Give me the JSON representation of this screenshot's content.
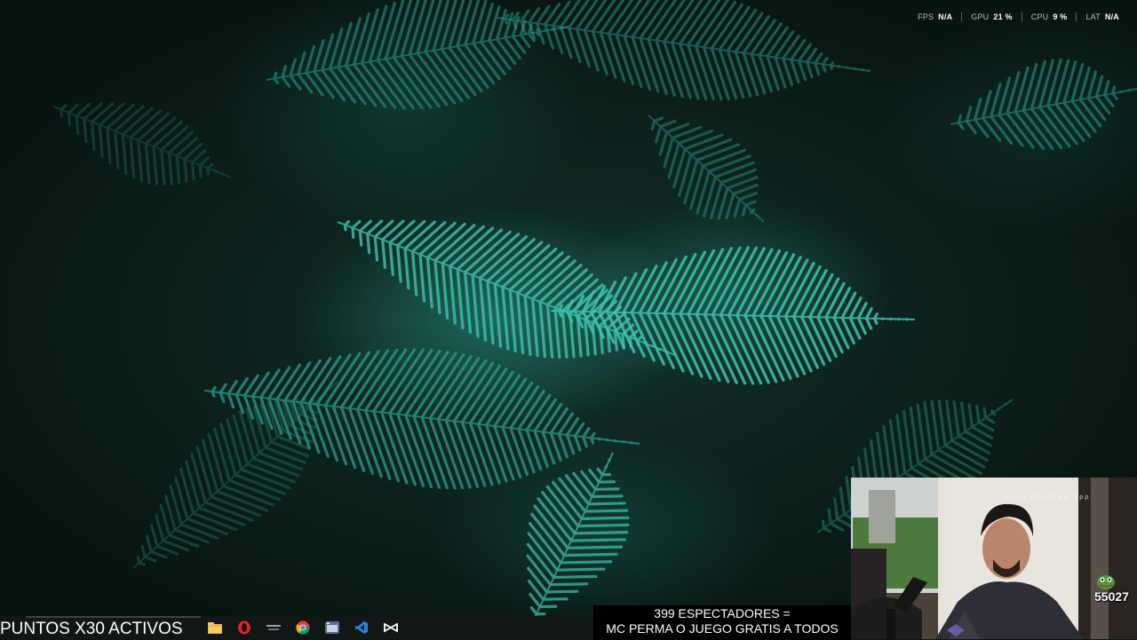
{
  "overlay": {
    "fps_label": "FPS",
    "fps_value": "N/A",
    "gpu_label": "GPU",
    "gpu_value": "21 %",
    "cpu_label": "CPU",
    "cpu_value": "9 %",
    "lat_label": "LAT",
    "lat_value": "N/A"
  },
  "stream": {
    "points_text": "PUNTOS X30 ACTIVOS",
    "viewers_line": "399 ESPECTADORES =",
    "promo_line": "MC PERMA O JUEGO GRATIS A TODOS",
    "webcam_watermark": "using droidcam app",
    "sub_counter": "55027"
  },
  "taskbar": {
    "icons": [
      "file-explorer-icon",
      "opera-browser-icon",
      "lunar-client-icon",
      "chrome-icon",
      "app-window-icon",
      "visual-studio-icon",
      "capcut-icon"
    ]
  },
  "colors": {
    "fern": "#2a9e8d",
    "fern_bright": "#3fc4b1",
    "background": "#0b1613",
    "taskbar": "#111617"
  }
}
